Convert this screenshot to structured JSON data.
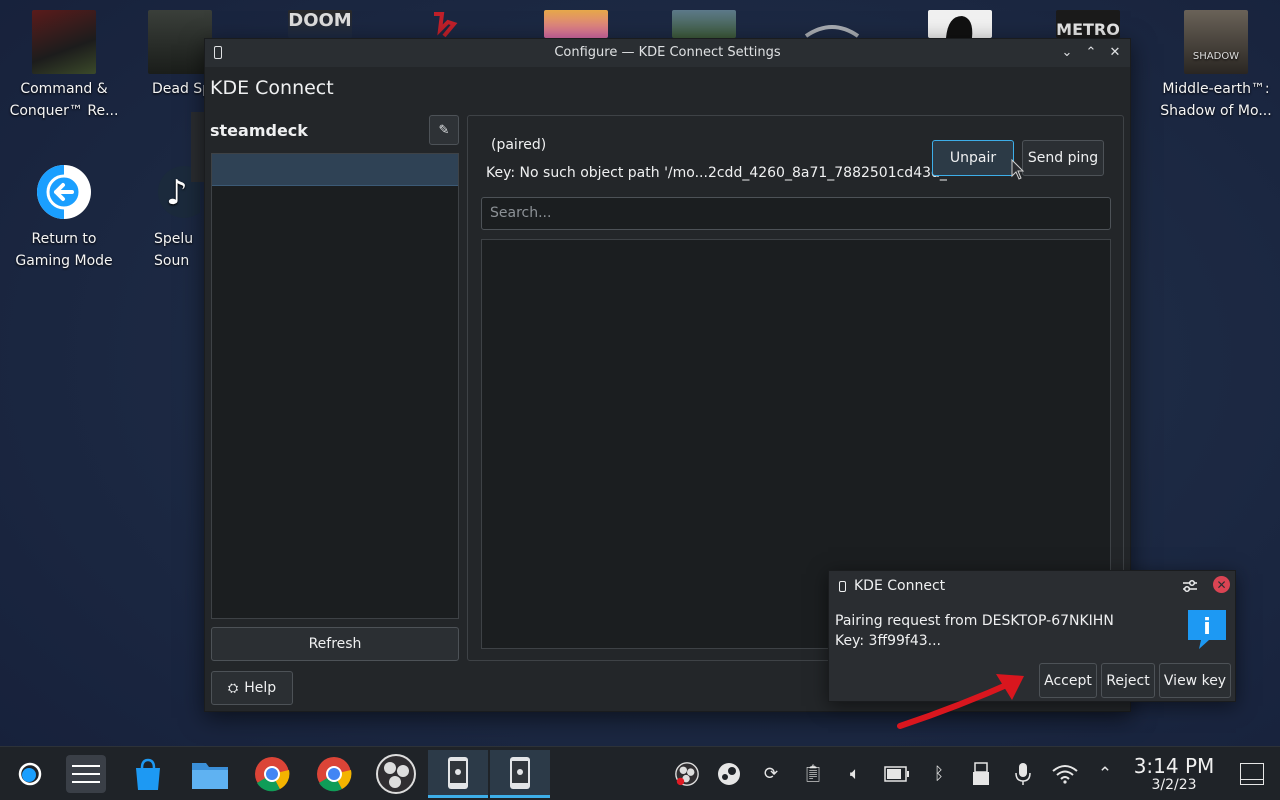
{
  "desktop": {
    "icons": [
      {
        "label": "Command &\nConquer™ Re..."
      },
      {
        "label": "Dead Sp"
      },
      {
        "label": "Return to\nGaming Mode"
      },
      {
        "label": "Spelu\nSoun"
      },
      {
        "label": "Middle-earth™:\nShadow of Mo..."
      }
    ]
  },
  "window": {
    "title": "Configure — KDE Connect Settings",
    "app_title": "KDE Connect",
    "device_name": "steamdeck",
    "refresh_label": "Refresh",
    "help_label": "Help",
    "device": {
      "status": "(paired)",
      "key_line": "Key: No such object path '/mo...2cdd_4260_8a71_7882501cd43d_'",
      "unpair_label": "Unpair",
      "ping_label": "Send ping",
      "search_placeholder": "Search..."
    }
  },
  "notification": {
    "app": "KDE Connect",
    "line1": "Pairing request from DESKTOP-67NKIHN",
    "line2": "Key: 3ff99f43...",
    "accept_label": "Accept",
    "reject_label": "Reject",
    "view_key_label": "View key"
  },
  "taskbar": {
    "time": "3:14 PM",
    "date": "3/2/23"
  },
  "colors": {
    "accent": "#3daee9",
    "close_red": "#da4453",
    "annotation_arrow": "#d9161e"
  }
}
